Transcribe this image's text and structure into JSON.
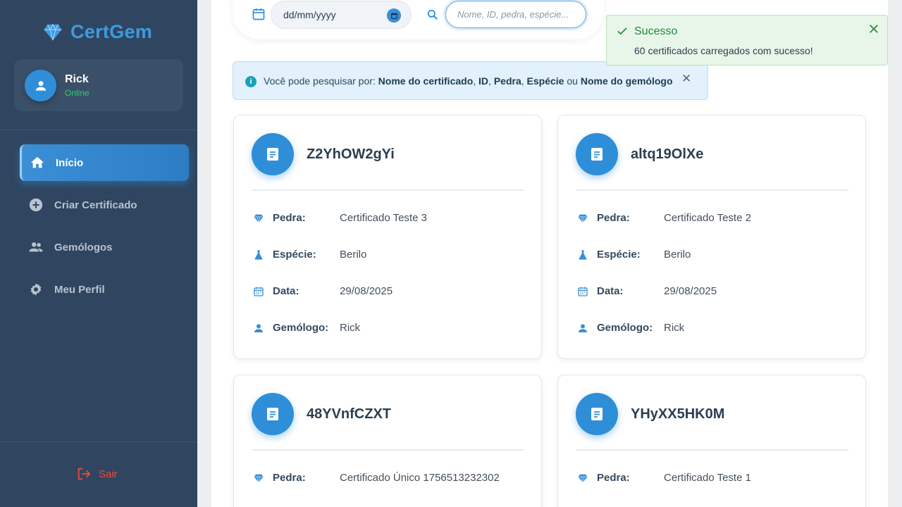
{
  "brand": {
    "name": "CertGem",
    "icon": "gem-icon",
    "color": "#3d9be0"
  },
  "user": {
    "name": "Rick",
    "status": "Online",
    "status_color": "#2ecc71"
  },
  "sidebar": {
    "items": [
      {
        "label": "Início",
        "icon": "home-icon",
        "active": true
      },
      {
        "label": "Criar Certificado",
        "icon": "add-circle-icon",
        "active": false
      },
      {
        "label": "Gemólogos",
        "icon": "people-icon",
        "active": false
      },
      {
        "label": "Meu Perfil",
        "icon": "gear-icon",
        "active": false
      }
    ],
    "logout_label": "Sair"
  },
  "filters": {
    "date_placeholder": "dd/mm/yyyy",
    "search_placeholder": "Nome, ID, pedra, espécie..."
  },
  "info": {
    "prefix": "Você pode pesquisar por:",
    "field1": "Nome do certificado",
    "field2": "ID",
    "field3": "Pedra",
    "field4": "Espécie",
    "or_word": "ou",
    "field5": "Nome do gemólogo"
  },
  "toast": {
    "title": "Sucesso",
    "message": "60 certificados carregados com sucesso!"
  },
  "labels": {
    "pedra": "Pedra:",
    "especie": "Espécie:",
    "data": "Data:",
    "gemologo": "Gemólogo:"
  },
  "certificates": [
    {
      "id": "Z2YhOW2gYi",
      "pedra": "Certificado Teste 3",
      "especie": "Berilo",
      "data": "29/08/2025",
      "gemologo": "Rick"
    },
    {
      "id": "altq19OlXe",
      "pedra": "Certificado Teste 2",
      "especie": "Berilo",
      "data": "29/08/2025",
      "gemologo": "Rick"
    },
    {
      "id": "48YVnfCZXT",
      "pedra": "Certificado Único 1756513232302"
    },
    {
      "id": "YHyXX5HK0M",
      "pedra": "Certificado Teste 1"
    }
  ],
  "colors": {
    "sidebar_bg": "#2f4560",
    "accent": "#2f8ed8",
    "danger": "#e74c3c",
    "success": "#1e8b3a"
  }
}
